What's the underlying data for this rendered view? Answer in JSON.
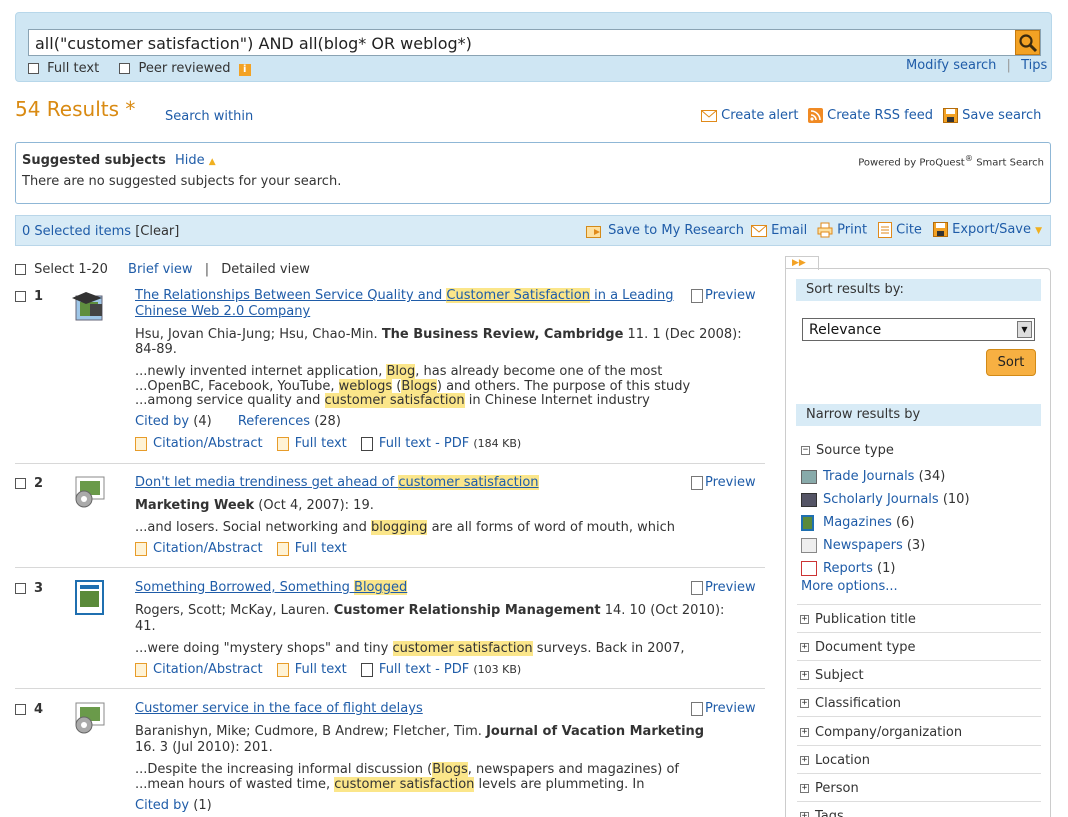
{
  "search": {
    "query": "all(\"customer satisfaction\") AND all(blog* OR weblog*)",
    "full_text_label": "Full text",
    "peer_reviewed_label": "Peer reviewed",
    "modify_search": "Modify search",
    "sep": "|",
    "tips": "Tips"
  },
  "results_header": {
    "count": "54 Results *",
    "search_within": "Search within",
    "create_alert": "Create alert",
    "create_rss": "Create RSS feed",
    "save_search": "Save search"
  },
  "suggested": {
    "title": "Suggested subjects",
    "hide": "Hide",
    "powered_by": "Powered by ProQuest",
    "reg": "®",
    "smart": " Smart Search",
    "message": "There are no suggested subjects for your search."
  },
  "toolbar": {
    "selected": "0 Selected items",
    "clear": "[Clear]",
    "save_research": "Save to My Research",
    "email": "Email",
    "print": "Print",
    "cite": "Cite",
    "export": "Export/Save"
  },
  "list_controls": {
    "select": "Select 1-20",
    "brief": "Brief view",
    "sep": "|",
    "detailed": "Detailed view"
  },
  "preview_label": "Preview",
  "cited_by": "Cited by",
  "references": "References",
  "citation_abstract": "Citation/Abstract",
  "full_text": "Full text",
  "full_text_pdf": "Full text - PDF",
  "results": [
    {
      "num": "1",
      "title_a": "The Relationships Between Service Quality and ",
      "title_hl": "Customer Satisfaction",
      "title_b": " in a Leading",
      "title_line2": "Chinese Web 2.0 Company",
      "authors": "Hsu, Jovan Chia-Jung; Hsu, Chao-Min. ",
      "source": "The Business Review, Cambridge",
      "details": " 11. 1  (Dec 2008): 84-89.",
      "s1a": "...newly invented internet application, ",
      "s1h": "Blog",
      "s1b": ", has already become one of the most",
      "s2a": "...OpenBC, Facebook, YouTube, ",
      "s2h": "weblogs",
      "s2b": " (",
      "s2h2": "Blogs",
      "s2c": ") and others. The purpose of this study",
      "s3a": "...among service quality and ",
      "s3h": "customer satisfaction",
      "s3b": " in Chinese Internet industry",
      "cited_count": "(4)",
      "ref_count": "(28)",
      "pdf_size": "(184 KB)"
    },
    {
      "num": "2",
      "title_a": "Don't let media trendiness get ahead of ",
      "title_hl": "customer satisfaction",
      "source": "Marketing Week",
      "details": " (Oct 4, 2007): 19.",
      "s1a": "...and losers. Social networking and ",
      "s1h": "blogging",
      "s1b": " are all forms of word of mouth, which"
    },
    {
      "num": "3",
      "title_a": "Something Borrowed, Something ",
      "title_hl": "Blogged",
      "authors": "Rogers, Scott; McKay, Lauren. ",
      "source": "Customer Relationship Management",
      "details": " 14. 10  (Oct 2010):",
      "details2": "41.",
      "s1a": "...were doing \"mystery shops\" and tiny ",
      "s1h": "customer satisfaction",
      "s1b": " surveys. Back in 2007,",
      "pdf_size": "(103 KB)"
    },
    {
      "num": "4",
      "title_a": "Customer service in the face of flight delays",
      "authors": "Baranishyn, Mike; Cudmore, B Andrew; Fletcher, Tim. ",
      "source": "Journal of Vacation Marketing",
      "details2": "16. 3  (Jul 2010): 201.",
      "s1a": "...Despite the increasing informal discussion (",
      "s1h": "Blogs",
      "s1b": ", newspapers and magazines) of",
      "s2a": "...mean hours of wasted time, ",
      "s2h": "customer satisfaction",
      "s2b": " levels are plummeting. In",
      "cited_count": "(1)"
    }
  ],
  "sidebar": {
    "sort_header": "Sort results by:",
    "sort_value": "Relevance",
    "sort_button": "Sort",
    "narrow_header": "Narrow results by",
    "source_type": "Source type",
    "sources": [
      {
        "label": "Trade Journals",
        "count": "(34)"
      },
      {
        "label": "Scholarly Journals",
        "count": "(10)"
      },
      {
        "label": "Magazines",
        "count": "(6)"
      },
      {
        "label": "Newspapers",
        "count": "(3)"
      },
      {
        "label": "Reports",
        "count": "(1)"
      }
    ],
    "more_options": "More options...",
    "facets": [
      "Publication title",
      "Document type",
      "Subject",
      "Classification",
      "Company/organization",
      "Location",
      "Person",
      "Tags"
    ]
  },
  "colors": {
    "accent_orange": "#f3a224",
    "link_blue": "#1f5ca8",
    "highlight": "#fbe68a",
    "panel_blue": "#cfe6f3"
  }
}
